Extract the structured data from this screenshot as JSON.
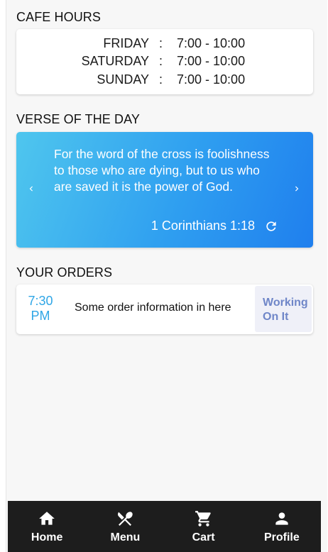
{
  "cafe_hours": {
    "title": "CAFE HOURS",
    "rows": [
      {
        "day": "FRIDAY",
        "sep": ":",
        "time": "7:00 - 10:00"
      },
      {
        "day": "SATURDAY",
        "sep": ":",
        "time": "7:00 - 10:00"
      },
      {
        "day": "SUNDAY",
        "sep": ":",
        "time": "7:00 - 10:00"
      }
    ]
  },
  "verse": {
    "title": "VERSE OF THE DAY",
    "text": "For the word of the cross is foolishness to those who are dying, but to us who are saved it is the power of God.",
    "reference": "1 Corinthians 1:18",
    "icons": {
      "prev": "chevron-left-icon",
      "next": "chevron-right-icon",
      "refresh": "refresh-icon"
    },
    "gradient": [
      "#4fc6ee",
      "#1f7fee"
    ]
  },
  "orders": {
    "title": "YOUR ORDERS",
    "items": [
      {
        "time_hm": "7:30",
        "time_ampm": "PM",
        "info": "Some order information in here",
        "status_line1": "Working",
        "status_line2": "On It"
      }
    ]
  },
  "nav": {
    "items": [
      {
        "label": "Home",
        "icon": "home-icon"
      },
      {
        "label": "Menu",
        "icon": "fork-knife-icon"
      },
      {
        "label": "Cart",
        "icon": "cart-icon"
      },
      {
        "label": "Profile",
        "icon": "person-icon"
      }
    ]
  },
  "colors": {
    "accent": "#2fa6e6",
    "status_text": "#6f86c8",
    "status_bg": "#eff0f8",
    "nav_bg": "#1d1d1d"
  }
}
